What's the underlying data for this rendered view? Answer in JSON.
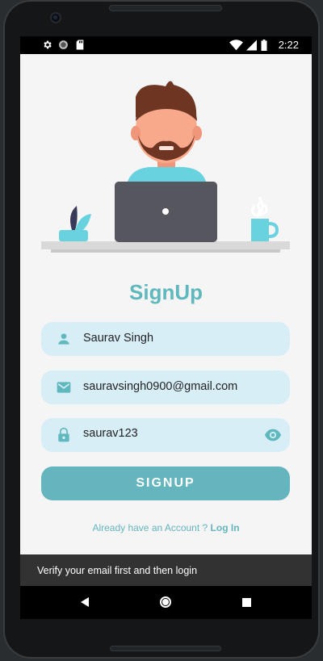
{
  "status_bar": {
    "time": "2:22",
    "left_icons": [
      "settings-icon",
      "circle-status-icon",
      "sd-card-icon"
    ],
    "right_icons": [
      "wifi-icon",
      "signal-icon",
      "battery-icon"
    ]
  },
  "illustration": {
    "description_icon": "person-with-laptop-illustration",
    "colors": {
      "skin": "#f9a98b",
      "hair": "#6e3522",
      "shirt": "#68d2de",
      "laptop": "#55565e",
      "desk": "#d9d9d9",
      "cup": "#68d2de"
    }
  },
  "form": {
    "title": "SignUp",
    "fields": [
      {
        "icon": "person-icon",
        "value": "Saurav Singh"
      },
      {
        "icon": "mail-icon",
        "value": "sauravsingh0900@gmail.com"
      },
      {
        "icon": "lock-icon",
        "value": "saurav123",
        "trailing_icon": "eye-icon"
      }
    ],
    "submit_label": "SIGNUP",
    "footer_text": "Already have an Account ?",
    "footer_link": "Log In"
  },
  "snackbar": {
    "message": "Verify your email first and then login"
  },
  "nav_bar": {
    "buttons": [
      "back-icon",
      "home-icon",
      "recents-icon"
    ]
  },
  "colors": {
    "accent": "#64b5bd",
    "field_bg": "#d7eef7",
    "title": "#5fb8bd",
    "snackbar_bg": "#323232"
  }
}
